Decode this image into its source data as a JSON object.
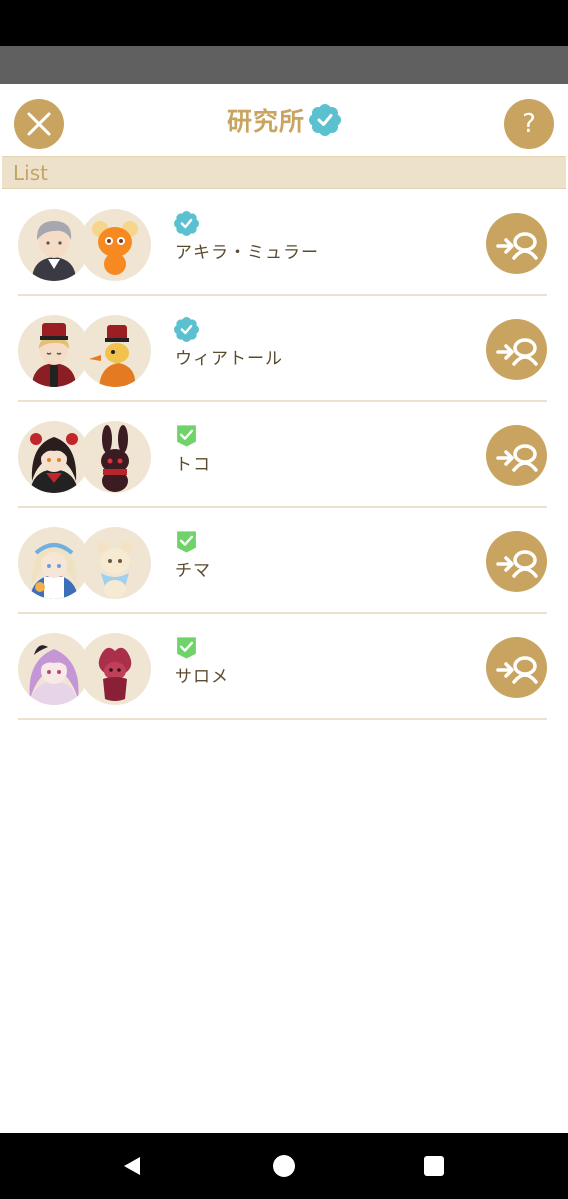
{
  "header": {
    "title": "研究所",
    "title_badge_icon": "teal-flower-badge-icon",
    "close_icon": "close-icon",
    "help_label": "?"
  },
  "section": {
    "label": "List"
  },
  "colors": {
    "gold": "#c9a461",
    "section_bg": "#ede1c9",
    "teal_badge": "#5bc0cf",
    "green_badge": "#6fd36a",
    "name_text": "#5a4a2e"
  },
  "items": [
    {
      "name": "アキラ・ミュラー",
      "badge": "teal-flower-badge-icon",
      "badge_color": "#5bc0cf",
      "action_icon": "summon-icon"
    },
    {
      "name": "ウィアトール",
      "badge": "teal-flower-badge-icon",
      "badge_color": "#5bc0cf",
      "action_icon": "summon-icon"
    },
    {
      "name": "トコ",
      "badge": "green-check-badge-icon",
      "badge_color": "#6fd36a",
      "action_icon": "summon-icon"
    },
    {
      "name": "チマ",
      "badge": "green-check-badge-icon",
      "badge_color": "#6fd36a",
      "action_icon": "summon-icon"
    },
    {
      "name": "サロメ",
      "badge": "green-check-badge-icon",
      "badge_color": "#6fd36a",
      "action_icon": "summon-icon"
    }
  ],
  "nav": {
    "back_icon": "back-triangle-icon",
    "home_icon": "home-circle-icon",
    "recent_icon": "recents-square-icon"
  }
}
